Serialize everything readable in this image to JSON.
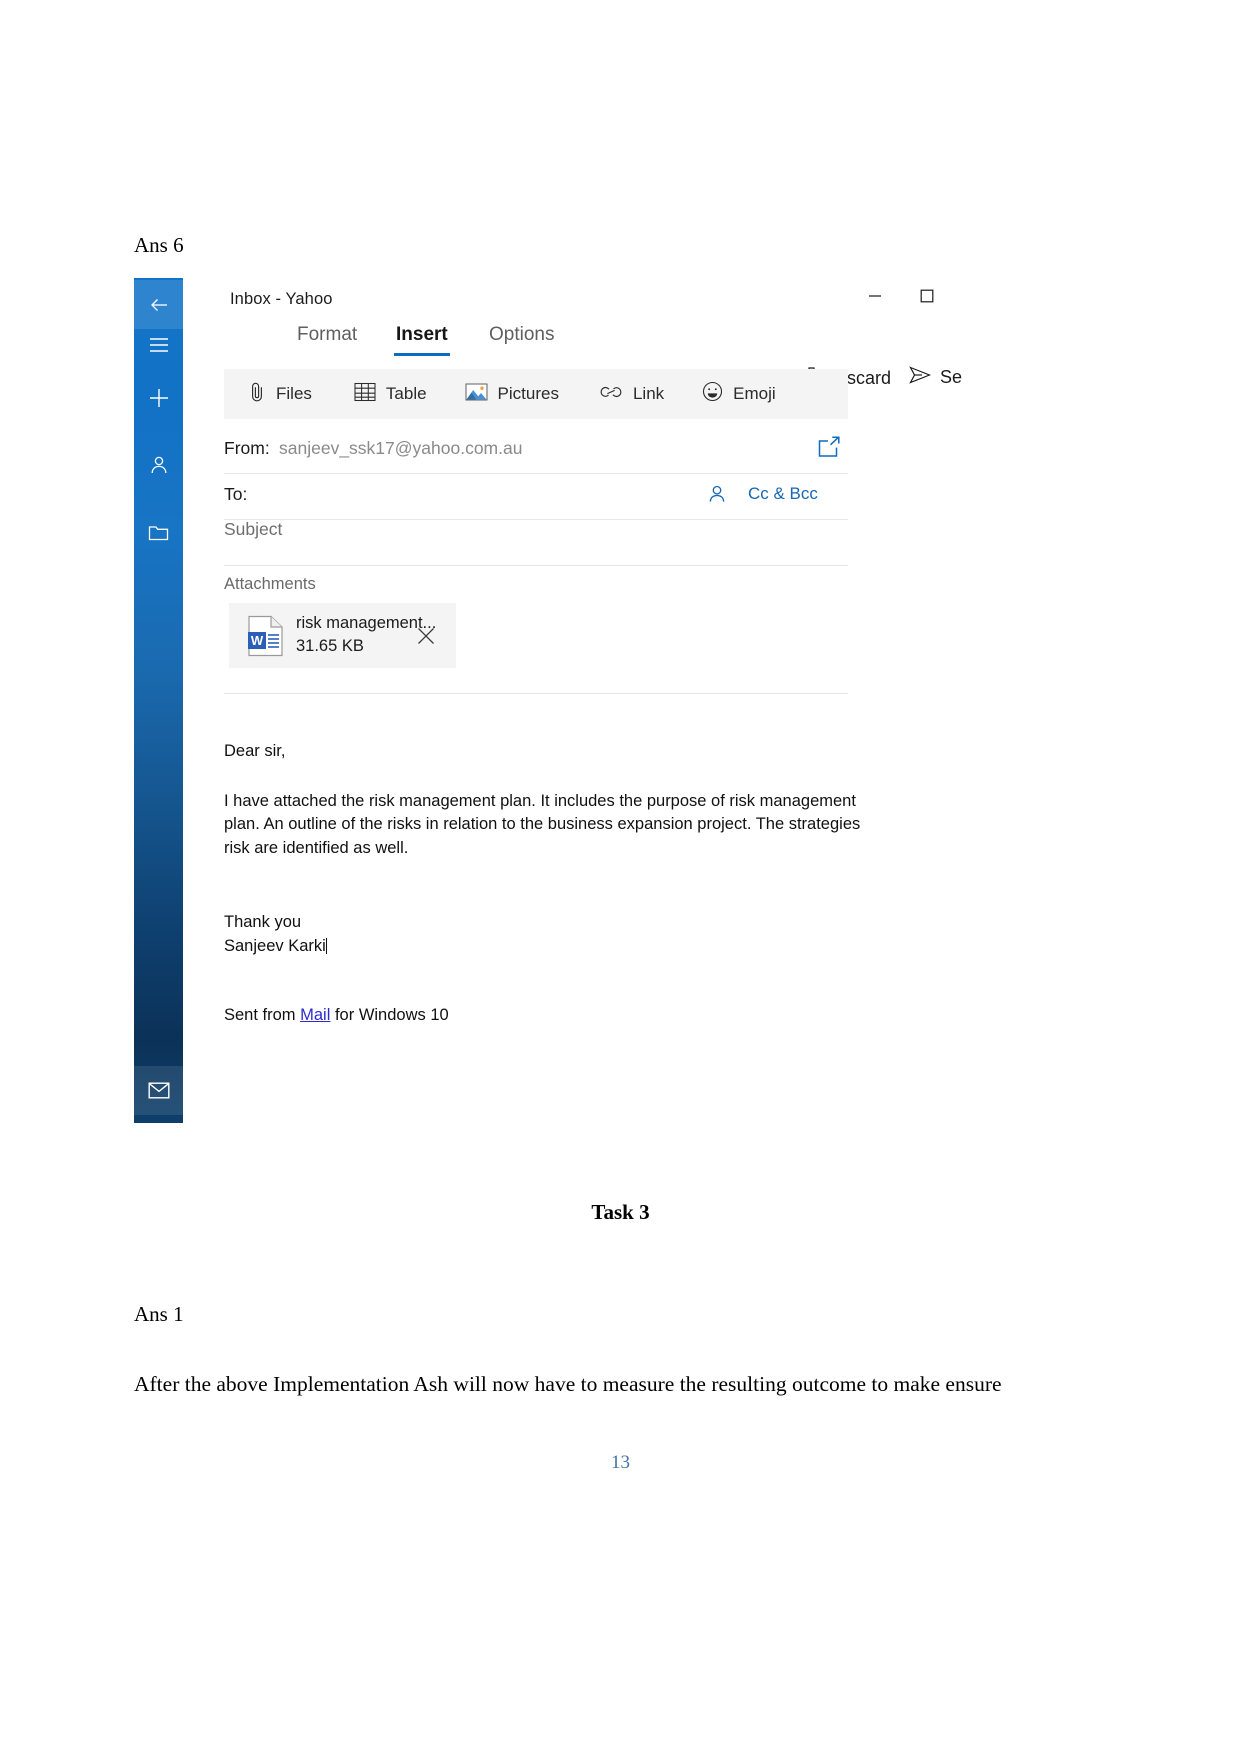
{
  "document": {
    "ans6_label": "Ans 6",
    "task3_heading": "Task 3",
    "ans1_label": "Ans 1",
    "body_paragraph": "After the above Implementation Ash will now have to measure the resulting outcome to make ensure",
    "page_number": "13"
  },
  "mail_window": {
    "title": "Inbox - Yahoo",
    "window_controls": {
      "minimize": "minimize-icon",
      "maximize": "maximize-icon",
      "close": "close-icon"
    },
    "nav_rail": {
      "items": [
        {
          "name": "back",
          "icon": "back-arrow-icon",
          "selected": true
        },
        {
          "name": "menu",
          "icon": "hamburger-menu-icon",
          "selected": false
        },
        {
          "name": "new-mail",
          "icon": "plus-icon",
          "selected": false
        },
        {
          "name": "people",
          "icon": "person-icon",
          "selected": false
        },
        {
          "name": "folders",
          "icon": "folder-icon",
          "selected": false
        },
        {
          "name": "mail",
          "icon": "envelope-icon",
          "selected": false
        }
      ]
    },
    "ribbon": {
      "tabs": [
        {
          "label": "Format",
          "active": false
        },
        {
          "label": "Insert",
          "active": true
        },
        {
          "label": "Options",
          "active": false
        }
      ],
      "commands": [
        {
          "label": "Discard",
          "icon": "trash-icon"
        },
        {
          "label": "Send",
          "icon": "send-arrow-icon"
        }
      ]
    },
    "insert_toolbar": {
      "items": [
        {
          "label": "Files",
          "icon": "paperclip-icon"
        },
        {
          "label": "Table",
          "icon": "table-icon"
        },
        {
          "label": "Pictures",
          "icon": "picture-icon"
        },
        {
          "label": "Link",
          "icon": "link-icon"
        },
        {
          "label": "Emoji",
          "icon": "emoji-icon"
        }
      ]
    },
    "compose": {
      "from_label": "From:",
      "from_value": "sanjeev_ssk17@yahoo.com.au",
      "expand_icon": "pop-out-icon",
      "to_label": "To:",
      "to_value": "",
      "to_people_icon": "person-picker-icon",
      "cc_bcc_label": "Cc & Bcc",
      "subject_placeholder": "Subject",
      "subject_value": ""
    },
    "attachments": {
      "section_label": "Attachments",
      "items": [
        {
          "file_name": "risk management...",
          "file_size": "31.65 KB",
          "file_type_icon": "word-document-icon",
          "remove_icon": "close-icon"
        }
      ]
    },
    "body": {
      "greeting": "Dear sir,",
      "paragraph": "I have attached the risk management plan. It includes the purpose of risk management plan. An outline of the risks in relation to the business expansion project. The strategies risk are identified as well.",
      "sign_off_line1": "Thank you",
      "sign_off_line2": "Sanjeev Karki",
      "sent_from_prefix": "Sent from ",
      "sent_from_link": "Mail",
      "sent_from_suffix": " for Windows 10"
    }
  },
  "colors": {
    "accent_blue": "#0f6cbd",
    "link_blue": "#1667b5",
    "rail_blue_top": "#1274c8",
    "rail_blue_bottom": "#0b3258",
    "toolbar_grey": "#f4f4f4",
    "page_number_blue": "#4472a8"
  }
}
